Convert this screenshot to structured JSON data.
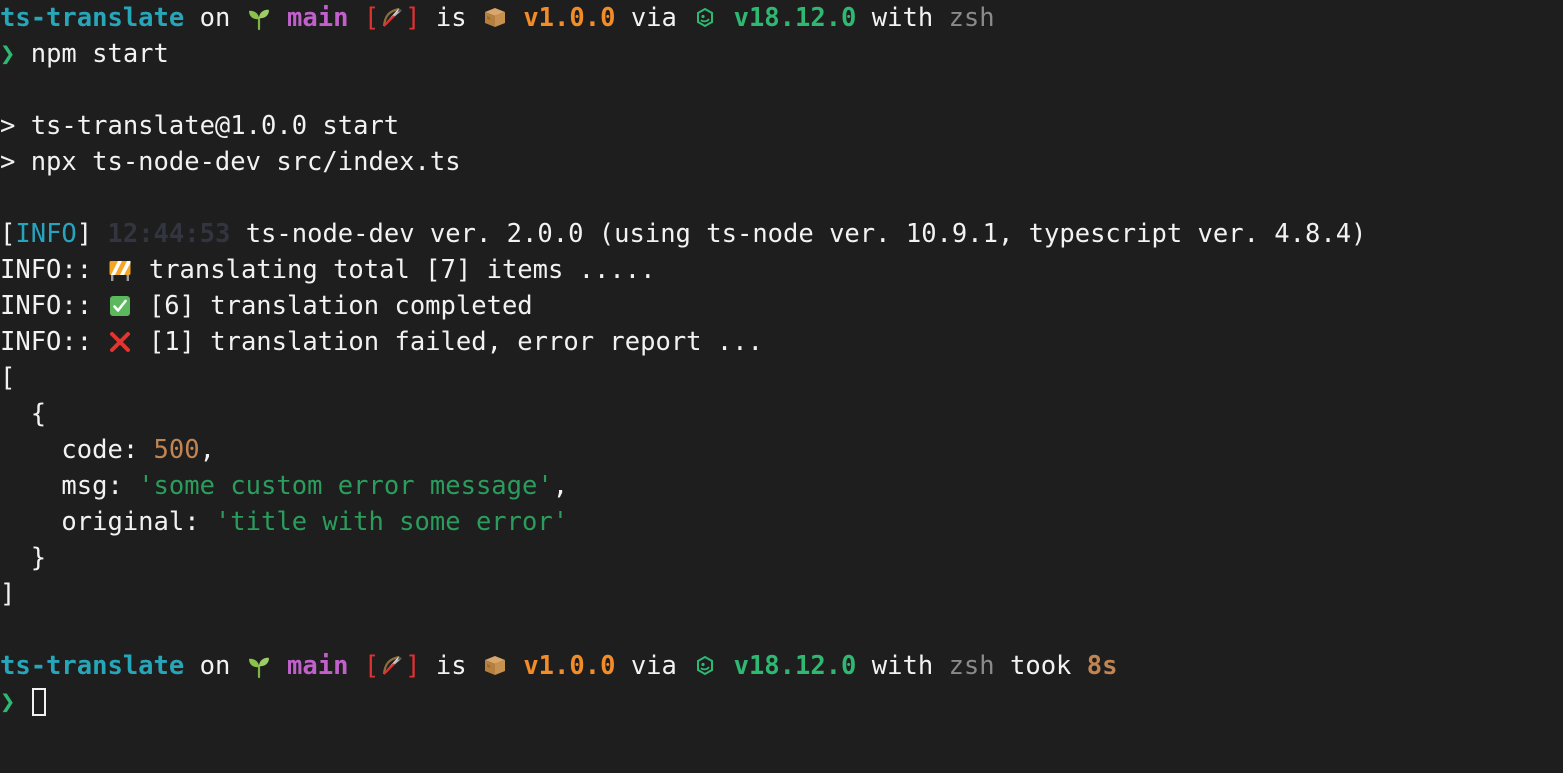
{
  "terminal": {
    "background_color": "#1e1e1e",
    "foreground_color": "#f2f2f2",
    "colors": {
      "project": "#26a6b8",
      "branch": "#c061cb",
      "bracket": "#e03131",
      "package_version": "#f28c28",
      "node_version": "#2eb872",
      "shell": "#8a8a8a",
      "duration": "#c08552",
      "chevron": "#2eb872",
      "info_label": "#27a4bd",
      "timestamp": "#32353f",
      "number": "#c08552",
      "string": "#2a9d5c"
    }
  },
  "prompt_first": {
    "project": "ts-translate",
    "on": "on",
    "seedling_icon": "seedling-emoji",
    "branch": "main",
    "bracket_open": "[",
    "bow_icon": "bow-and-arrow-emoji",
    "bracket_close": "]",
    "is": "is",
    "package_icon": "package-emoji",
    "package_version": "v1.0.0",
    "via": "via",
    "node_icon": "nodejs-icon",
    "node_version": "v18.12.0",
    "with": "with",
    "shell": "zsh"
  },
  "command_line": {
    "chevron": "❯",
    "command": "npm start"
  },
  "npm_output": [
    "> ts-translate@1.0.0 start",
    "> npx ts-node-dev src/index.ts"
  ],
  "ts_node_dev_log": {
    "bracket_open": "[",
    "level": "INFO",
    "bracket_close": "]",
    "timestamp": "12:44:53",
    "message": "ts-node-dev ver. 2.0.0 (using ts-node ver. 10.9.1, typescript ver. 4.8.4)"
  },
  "info_lines": [
    {
      "prefix": "INFO::",
      "icon": "construction-emoji",
      "message": "translating total [7] items ....."
    },
    {
      "prefix": "INFO::",
      "icon": "check-mark-button-emoji",
      "message": "[6] translation completed"
    },
    {
      "prefix": "INFO::",
      "icon": "cross-mark-emoji",
      "message": "[1] translation failed, error report ..."
    }
  ],
  "error_report": {
    "array_open": "[",
    "object_open": "{",
    "fields": [
      {
        "key": "code:",
        "value": "500",
        "type": "number",
        "trailing": ","
      },
      {
        "key": "msg:",
        "value": "'some custom error message'",
        "type": "string",
        "trailing": ","
      },
      {
        "key": "original:",
        "value": "'title with some error'",
        "type": "string",
        "trailing": ""
      }
    ],
    "object_close": "}",
    "array_close": "]"
  },
  "prompt_second": {
    "project": "ts-translate",
    "on": "on",
    "seedling_icon": "seedling-emoji",
    "branch": "main",
    "bracket_open": "[",
    "bow_icon": "bow-and-arrow-emoji",
    "bracket_close": "]",
    "is": "is",
    "package_icon": "package-emoji",
    "package_version": "v1.0.0",
    "via": "via",
    "node_icon": "nodejs-icon",
    "node_version": "v18.12.0",
    "with": "with",
    "shell": "zsh",
    "took_label": "took",
    "took_value": "8s"
  },
  "command_line_second": {
    "chevron": "❯",
    "command": ""
  }
}
